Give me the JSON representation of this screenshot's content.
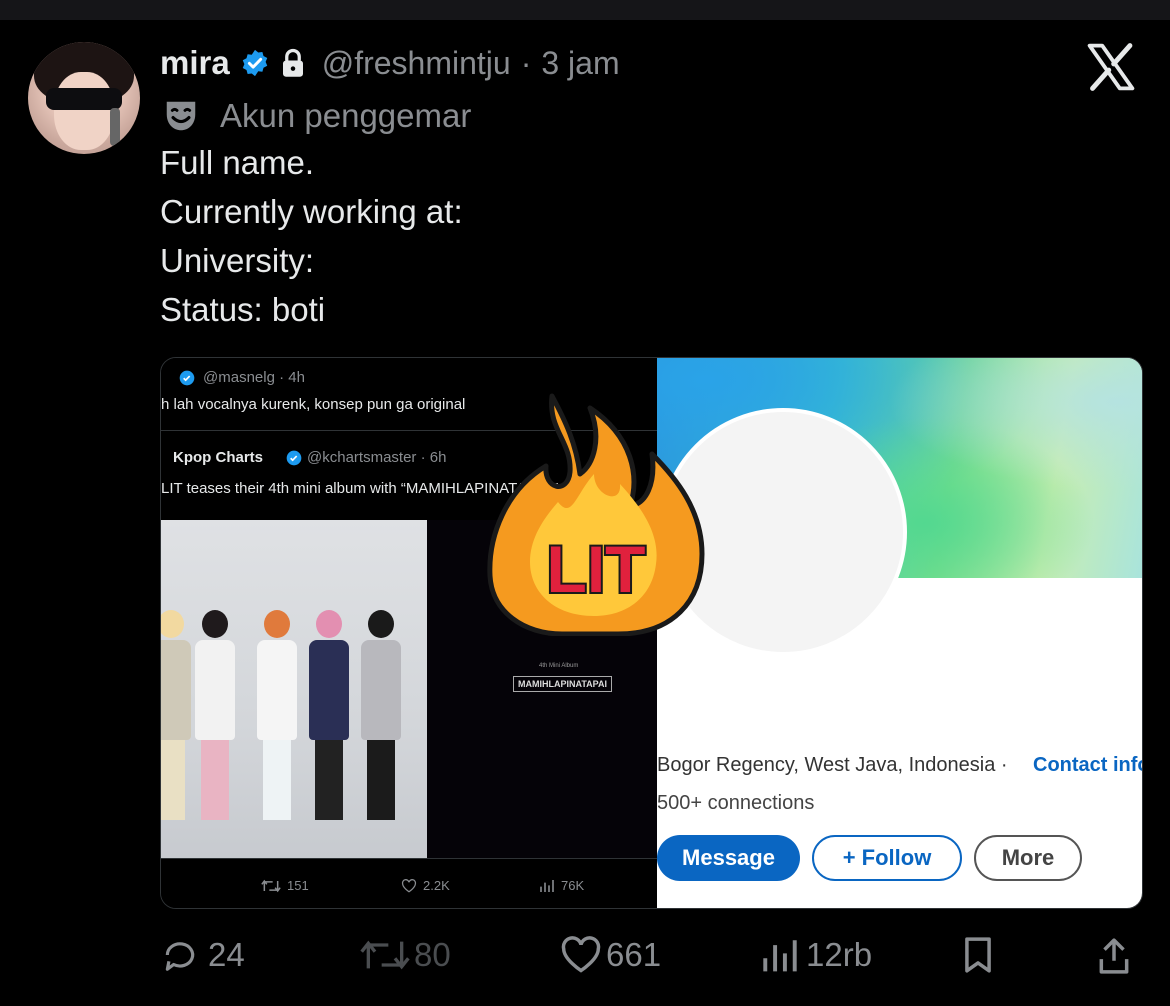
{
  "tweet": {
    "display_name": "mira",
    "handle": "@freshmintju",
    "separator": "·",
    "time": "3 jam",
    "account_label": "Akun penggemar",
    "bio_lines": [
      "Full name.",
      "Currently working at:",
      "University:",
      "Status: boti"
    ]
  },
  "screenshot_left": {
    "reply_handle": "@masnelg · 4h",
    "reply_text": "h lah vocalnya kurenk, konsep pun ga original",
    "quoted_name": "Kpop Charts",
    "quoted_handle": "@kchartsmaster · 6h",
    "quoted_text": "LIT teases their 4th mini album with “MAMIHLAPINATAPAI.”",
    "poster_small": "4th Mini Album",
    "poster_title": "MAMIHLAPINATAPAI",
    "retweets": "151",
    "likes": "2.2K",
    "views": "76K"
  },
  "screenshot_right": {
    "sticker_text": "LIT",
    "location": "Bogor Regency, West Java, Indonesia ·",
    "contact": "Contact info",
    "connections": "500+ connections",
    "message_label": "Message",
    "follow_label": "+ Follow",
    "more_label": "More"
  },
  "actions": {
    "replies": "24",
    "reposts": "80",
    "likes": "661",
    "views": "12rb"
  },
  "colors": {
    "verified": "#1d9bf0",
    "linkedin_blue": "#0a66c2",
    "muted_text": "#8a8d91",
    "fire_orange": "#f59a1f",
    "fire_red": "#e0213d"
  },
  "icons": [
    "verified-badge-icon",
    "lock-icon",
    "x-logo-icon",
    "theater-mask-icon",
    "reply-icon",
    "repost-icon",
    "like-icon",
    "views-icon",
    "bookmark-icon",
    "share-icon",
    "fire-sticker-icon"
  ]
}
